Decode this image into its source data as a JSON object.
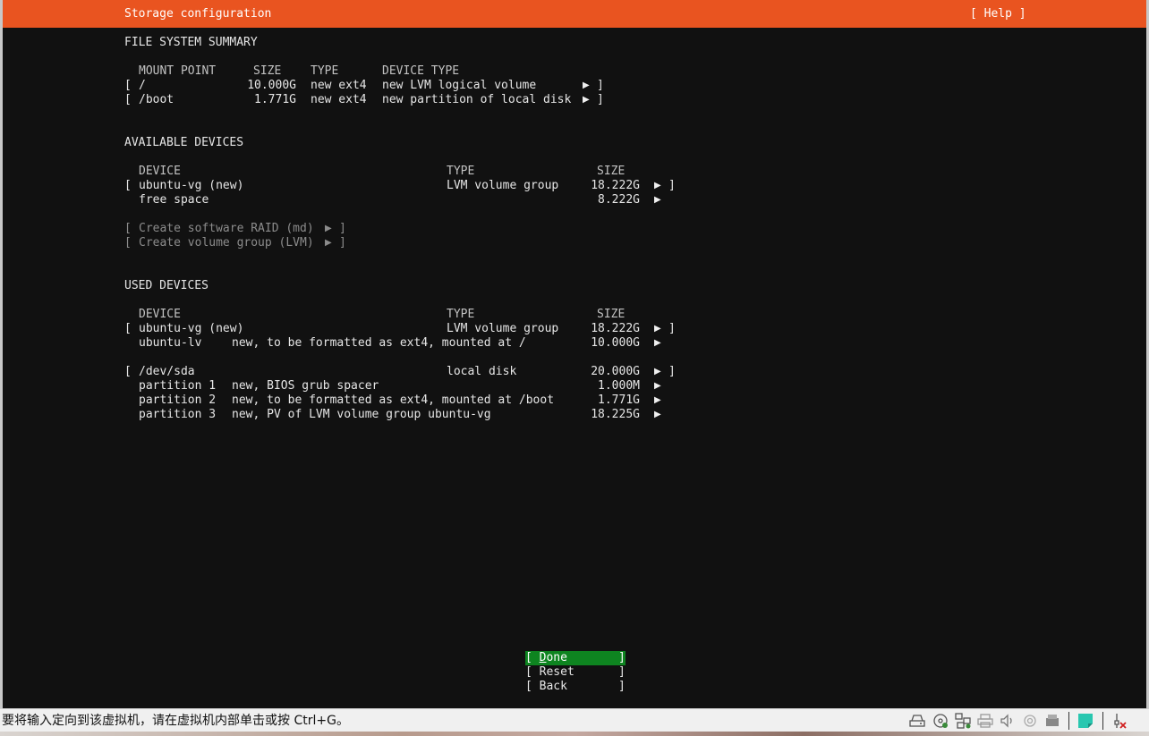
{
  "title": "Storage configuration",
  "help_label": "[ Help ]",
  "fs_summary": {
    "heading": "FILE SYSTEM SUMMARY",
    "headers": {
      "mount": "MOUNT POINT",
      "size": "SIZE",
      "type": "TYPE",
      "device_type": "DEVICE TYPE"
    },
    "rows": [
      {
        "mount": "/",
        "size": "10.000G",
        "type": "new ext4",
        "device_type": "new LVM logical volume"
      },
      {
        "mount": "/boot",
        "size": "1.771G",
        "type": "new ext4",
        "device_type": "new partition of local disk"
      }
    ]
  },
  "available": {
    "heading": "AVAILABLE DEVICES",
    "headers": {
      "device": "DEVICE",
      "type": "TYPE",
      "size": "SIZE"
    },
    "rows": [
      {
        "device": "ubuntu-vg (new)",
        "type": "LVM volume group",
        "size": "18.222G"
      },
      {
        "device": "free space",
        "type": "",
        "size": "8.222G"
      }
    ],
    "actions": [
      "Create software RAID (md)",
      "Create volume group (LVM)"
    ]
  },
  "used": {
    "heading": "USED DEVICES",
    "headers": {
      "device": "DEVICE",
      "type": "TYPE",
      "size": "SIZE"
    },
    "groups": [
      {
        "device": "ubuntu-vg (new)",
        "type": "LVM volume group",
        "size": "18.222G",
        "children": [
          {
            "name": "ubuntu-lv",
            "desc": "new, to be formatted as ext4, mounted at /",
            "size": "10.000G"
          }
        ]
      },
      {
        "device": "/dev/sda",
        "type": "local disk",
        "size": "20.000G",
        "children": [
          {
            "name": "partition 1",
            "desc": "new, BIOS grub spacer",
            "size": "1.000M"
          },
          {
            "name": "partition 2",
            "desc": "new, to be formatted as ext4, mounted at /boot",
            "size": "1.771G"
          },
          {
            "name": "partition 3",
            "desc": "new, PV of LVM volume group ubuntu-vg",
            "size": "18.225G"
          }
        ]
      }
    ]
  },
  "buttons": {
    "done_first": "D",
    "done_rest": "one",
    "reset": "Reset",
    "back": "Back"
  },
  "status_message": "要将输入定向到该虚拟机，请在虚拟机内部单击或按 Ctrl+G。",
  "tray_icons": [
    "hard-disk-icon",
    "cd-drive-icon",
    "network-icon",
    "printer-icon",
    "sound-icon",
    "usb-icon",
    "floppy-icon",
    "message-icon",
    "device-alert-icon"
  ],
  "colors": {
    "accent": "#e95420",
    "terminal_bg": "#111111",
    "done_button": "#0e8420"
  }
}
